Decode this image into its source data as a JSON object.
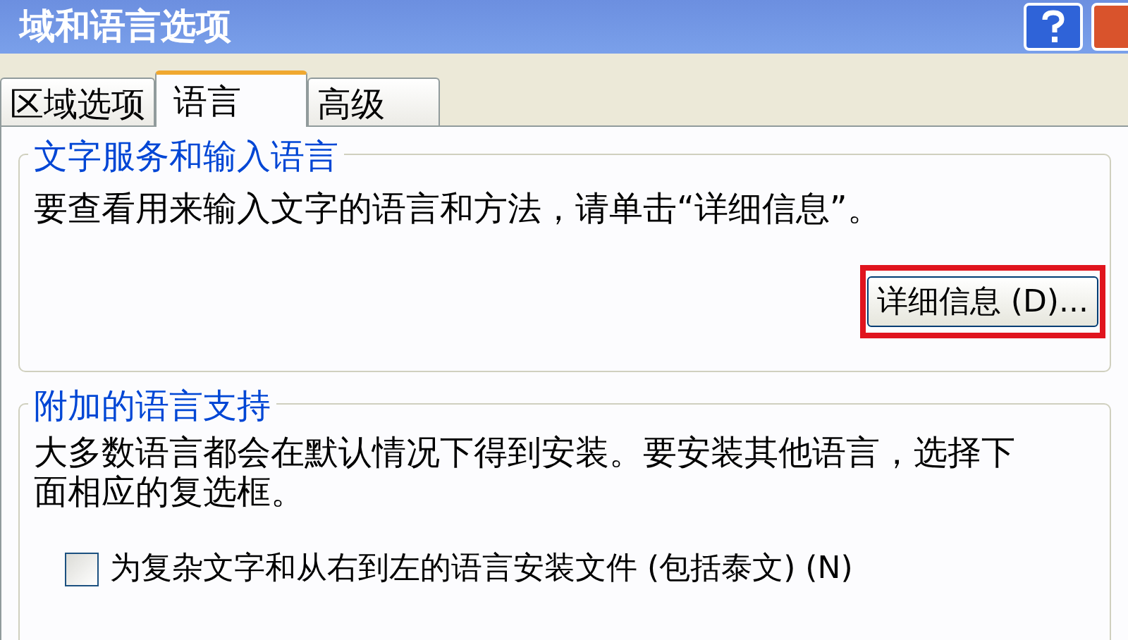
{
  "window": {
    "title": "域和语言选项"
  },
  "tabs": [
    {
      "label": "区域选项",
      "selected": false
    },
    {
      "label": "语言",
      "selected": true
    },
    {
      "label": "高级",
      "selected": false
    }
  ],
  "text_services": {
    "title": "文字服务和输入语言",
    "description": "要查看用来输入文字的语言和方法，请单击“详细信息”。",
    "button": "详细信息 (D)...",
    "highlighted": true
  },
  "supplemental": {
    "title": "附加的语言支持",
    "description": "大多数语言都会在默认情况下得到安装。要安装其他语言，选择下面相应的复选框。",
    "checkbox": {
      "label": "为复杂文字和从右到左的语言安装文件 (包括泰文) (N)",
      "checked": false
    }
  }
}
